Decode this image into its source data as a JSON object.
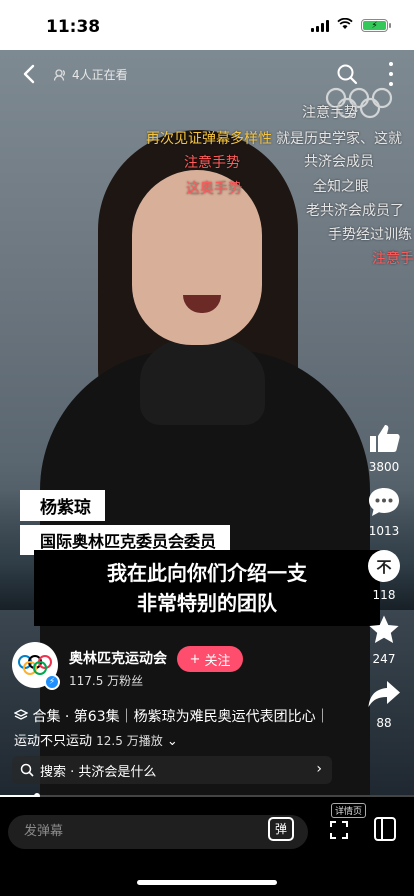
{
  "status": {
    "time": "11:38",
    "battery": "⚡"
  },
  "header": {
    "viewers": "4人正在看"
  },
  "danmaku": [
    {
      "text": "注意手势",
      "color": "#e6e6e6"
    },
    {
      "text": "再次见证弹幕多样性",
      "color": "#f4c542"
    },
    {
      "text": "就是历史学家、这就",
      "color": "#e6e6e6"
    },
    {
      "text": "注意手势",
      "color": "#ff5b5b"
    },
    {
      "text": "共济会成员",
      "color": "#e6e6e6"
    },
    {
      "text": "这奥手势",
      "color": "#ff5b5b"
    },
    {
      "text": "全知之眼",
      "color": "#e6e6e6"
    },
    {
      "text": "老共济会成员了",
      "color": "#e6e6e6"
    },
    {
      "text": "手势经过训练",
      "color": "#e6e6e6"
    },
    {
      "text": "注意手",
      "color": "#ff5b5b"
    }
  ],
  "video": {
    "name": "杨紫琼",
    "title": "国际奥林匹克委员会委员",
    "subtitle_line1": "我在此向你们介绍一支",
    "subtitle_line2": "非常特别的团队"
  },
  "actions": {
    "likes": "3800",
    "comments": "1013",
    "shares_label": "不",
    "shares": "118",
    "favorites": "247",
    "forwards": "88"
  },
  "creator": {
    "name": "奥林匹克运动会",
    "followers": "117.5 万粉丝",
    "follow_label": "关注"
  },
  "description": {
    "collection": "合集 · 第63集｜杨紫琼为难民奥运代表团比心｜",
    "tag": "运动不只运动",
    "plays": "12.5 万播放"
  },
  "related_search": {
    "label": "搜索 · 共济会是什么"
  },
  "bottom": {
    "danmaku_placeholder": "发弹幕",
    "danmaku_toggle": "弹",
    "detail": "详情页"
  },
  "colors": {
    "accent": "#ff4d6d",
    "verify": "#1e90ff",
    "battery": "#34c759"
  }
}
